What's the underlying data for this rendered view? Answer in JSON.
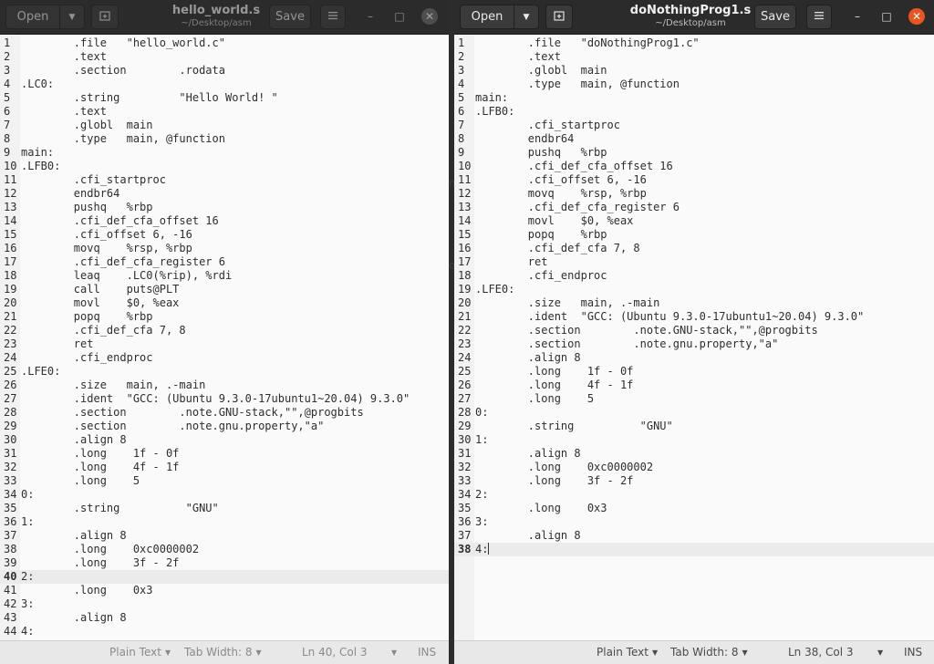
{
  "left": {
    "open_label": "Open",
    "save_label": "Save",
    "title": "hello_world.s",
    "subtitle": "~/Desktop/asm",
    "status": {
      "language": "Plain Text",
      "tab_width": "Tab Width: 8",
      "position": "Ln 40, Col 3",
      "mode": "INS"
    },
    "current_line": 40,
    "lines": [
      "        .file   \"hello_world.c\"",
      "        .text",
      "        .section        .rodata",
      ".LC0:",
      "        .string         \"Hello World! \"",
      "        .text",
      "        .globl  main",
      "        .type   main, @function",
      "main:",
      ".LFB0:",
      "        .cfi_startproc",
      "        endbr64",
      "        pushq   %rbp",
      "        .cfi_def_cfa_offset 16",
      "        .cfi_offset 6, -16",
      "        movq    %rsp, %rbp",
      "        .cfi_def_cfa_register 6",
      "        leaq    .LC0(%rip), %rdi",
      "        call    puts@PLT",
      "        movl    $0, %eax",
      "        popq    %rbp",
      "        .cfi_def_cfa 7, 8",
      "        ret",
      "        .cfi_endproc",
      ".LFE0:",
      "        .size   main, .-main",
      "        .ident  \"GCC: (Ubuntu 9.3.0-17ubuntu1~20.04) 9.3.0\"",
      "        .section        .note.GNU-stack,\"\",@progbits",
      "        .section        .note.gnu.property,\"a\"",
      "        .align 8",
      "        .long    1f - 0f",
      "        .long    4f - 1f",
      "        .long    5",
      "0:",
      "        .string          \"GNU\"",
      "1:",
      "        .align 8",
      "        .long    0xc0000002",
      "        .long    3f - 2f",
      "2:",
      "        .long    0x3",
      "3:",
      "        .align 8",
      "4:"
    ]
  },
  "right": {
    "open_label": "Open",
    "save_label": "Save",
    "title": "doNothingProg1.s",
    "subtitle": "~/Desktop/asm",
    "status": {
      "language": "Plain Text",
      "tab_width": "Tab Width: 8",
      "position": "Ln 38, Col 3",
      "mode": "INS"
    },
    "current_line": 38,
    "lines": [
      "        .file   \"doNothingProg1.c\"",
      "        .text",
      "        .globl  main",
      "        .type   main, @function",
      "main:",
      ".LFB0:",
      "        .cfi_startproc",
      "        endbr64",
      "        pushq   %rbp",
      "        .cfi_def_cfa_offset 16",
      "        .cfi_offset 6, -16",
      "        movq    %rsp, %rbp",
      "        .cfi_def_cfa_register 6",
      "        movl    $0, %eax",
      "        popq    %rbp",
      "        .cfi_def_cfa 7, 8",
      "        ret",
      "        .cfi_endproc",
      ".LFE0:",
      "        .size   main, .-main",
      "        .ident  \"GCC: (Ubuntu 9.3.0-17ubuntu1~20.04) 9.3.0\"",
      "        .section        .note.GNU-stack,\"\",@progbits",
      "        .section        .note.gnu.property,\"a\"",
      "        .align 8",
      "        .long    1f - 0f",
      "        .long    4f - 1f",
      "        .long    5",
      "0:",
      "        .string          \"GNU\"",
      "1:",
      "        .align 8",
      "        .long    0xc0000002",
      "        .long    3f - 2f",
      "2:",
      "        .long    0x3",
      "3:",
      "        .align 8",
      "4:"
    ]
  },
  "gap_fragments": [
    "n",
    "o"
  ],
  "icons": {
    "dropdown": "chevron-down-icon",
    "new_tab": "new-tab-icon",
    "menu": "hamburger-menu-icon",
    "minimize": "minimize-icon",
    "maximize": "maximize-icon",
    "close": "close-icon"
  },
  "colors": {
    "close_active": "#e95420",
    "header": "#2b2b2b",
    "editor_bg": "#fafafa"
  }
}
